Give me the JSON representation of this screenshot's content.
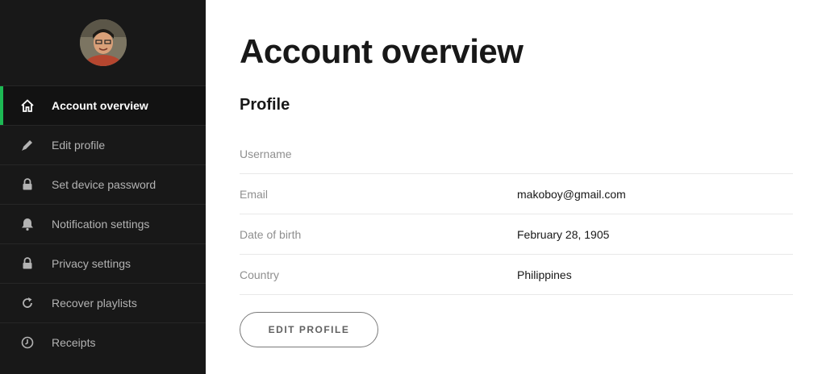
{
  "sidebar": {
    "items": [
      {
        "label": "Account overview",
        "icon": "home-icon",
        "active": true
      },
      {
        "label": "Edit profile",
        "icon": "pencil-icon",
        "active": false
      },
      {
        "label": "Set device password",
        "icon": "lock-icon",
        "active": false
      },
      {
        "label": "Notification settings",
        "icon": "bell-icon",
        "active": false
      },
      {
        "label": "Privacy settings",
        "icon": "lock-icon",
        "active": false
      },
      {
        "label": "Recover playlists",
        "icon": "refresh-icon",
        "active": false
      },
      {
        "label": "Receipts",
        "icon": "clock-icon",
        "active": false
      }
    ]
  },
  "main": {
    "title": "Account overview",
    "section_title": "Profile",
    "profile": {
      "rows": [
        {
          "label": "Username",
          "value": ""
        },
        {
          "label": "Email",
          "value": "makoboy@gmail.com"
        },
        {
          "label": "Date of birth",
          "value": "February 28, 1905"
        },
        {
          "label": "Country",
          "value": "Philippines"
        }
      ]
    },
    "edit_button_label": "EDIT PROFILE"
  },
  "colors": {
    "sidebar_bg": "#181818",
    "accent": "#1db954",
    "text_dark": "#181818",
    "text_muted": "#8f8f8f"
  }
}
